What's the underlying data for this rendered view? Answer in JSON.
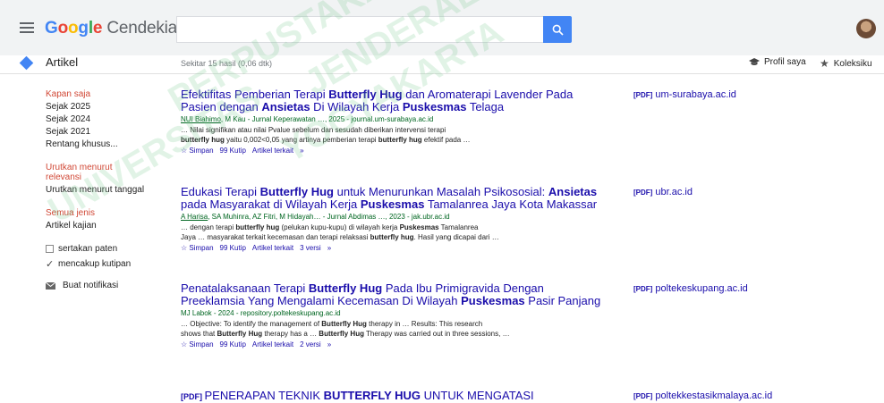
{
  "header": {
    "logo_google": "Google",
    "logo_cendekia": "Cendekia",
    "search_value": ""
  },
  "subbar": {
    "section": "Artikel",
    "results_count": "Sekitar 15 hasil (0,06 dtk)",
    "profile": "Profil saya",
    "collection": "Koleksiku"
  },
  "sidebar": {
    "time_head": "Kapan saja",
    "time_items": [
      "Sejak 2025",
      "Sejak 2024",
      "Sejak 2021",
      "Rentang khusus..."
    ],
    "sort_head": "Urutkan menurut relevansi",
    "sort_date": "Urutkan menurut tanggal",
    "type_head": "Semua jenis",
    "type_review": "Artikel kajian",
    "patents": "sertakan paten",
    "citations": "mencakup kutipan",
    "notify": "Buat notifikasi"
  },
  "results": [
    {
      "title_parts": [
        "Efektifitas Pemberian Terapi ",
        "Butterfly Hug",
        " dan Aromaterapi Lavender Pada Pasien dengan ",
        "Ansietas",
        " Di Wilayah Kerja ",
        "Puskesmas",
        " Telaga"
      ],
      "authors_link": "NUI Biahimo",
      "authors_rest": ", M Kau - Jurnal Keperawatan …, 2025 - journal.um-surabaya.ac.id",
      "snippet1": "… Nilai signifikan atau nilai Pvalue sebelum dan sesudah diberikan intervensi terapi",
      "snippet2_parts": [
        "butterfly hug",
        " yaitu 0,002<0,05 yang artinya pemberian terapi ",
        "butterfly hug",
        " efektif pada …"
      ],
      "save": "Simpan",
      "cite": "Kutip",
      "related": "Artikel terkait",
      "versions": "",
      "pdf_tag": "[PDF]",
      "pdf_source": "um-surabaya.ac.id"
    },
    {
      "title_parts": [
        "Edukasi Terapi ",
        "Butterfly Hug",
        " untuk Menurunkan Masalah Psikososial: ",
        "Ansietas",
        " pada Masyarakat di Wilayah Kerja ",
        "Puskesmas",
        " Tamalanrea Jaya Kota Makassar"
      ],
      "authors_link": "A Harisa",
      "authors_rest": ", SA Muhinra, AZ Fitri, M Hidayah… - Jurnal Abdimas …, 2023 - jak.ubr.ac.id",
      "snippet1_parts": [
        "… dengan terapi ",
        "butterfly hug",
        " (pelukan kupu-kupu) di wilayah kerja ",
        "Puskesmas",
        " Tamalanrea"
      ],
      "snippet2_parts": [
        "Jaya … masyarakat terkait kecemasan dan terapi relaksasi ",
        "butterfly hug",
        ". Hasil yang dicapai dari …"
      ],
      "save": "Simpan",
      "cite": "Kutip",
      "related": "Artikel terkait",
      "versions": "3 versi",
      "pdf_tag": "[PDF]",
      "pdf_source": "ubr.ac.id"
    },
    {
      "title_parts": [
        "Penatalaksanaan Terapi ",
        "Butterfly Hug",
        " Pada Ibu Primigravida Dengan Preeklamsia Yang Mengalami Kecemasan Di Wilayah ",
        "Puskesmas",
        " Pasir Panjang"
      ],
      "authors_rest": "MJ Labok - 2024 - repository.poltekeskupang.ac.id",
      "snippet1_parts": [
        "… Objective: To identify the management of ",
        "Butterfly Hug",
        " therapy in … Results: This research"
      ],
      "snippet2_parts": [
        "shows that ",
        "Butterfly Hug",
        " therapy has a … ",
        "Butterfly Hug",
        " Therapy was carried out in three sessions, …"
      ],
      "save": "Simpan",
      "cite": "Kutip",
      "related": "Artikel terkait",
      "versions": "2 versi",
      "pdf_tag": "[PDF]",
      "pdf_source": "poltekeskupang.ac.id"
    },
    {
      "title_tag": "[PDF]",
      "title_parts": [
        "PENERAPAN TEKNIK ",
        "BUTTERFLY HUG",
        " UNTUK MENGATASI"
      ],
      "pdf_tag": "[PDF]",
      "pdf_source": "poltekkestasikmalaya.ac.id"
    }
  ],
  "watermark": [
    "PERPUSTAKAAN",
    "UNIVERSITAS",
    "JENDERAL",
    "YOGYAKARTA"
  ]
}
